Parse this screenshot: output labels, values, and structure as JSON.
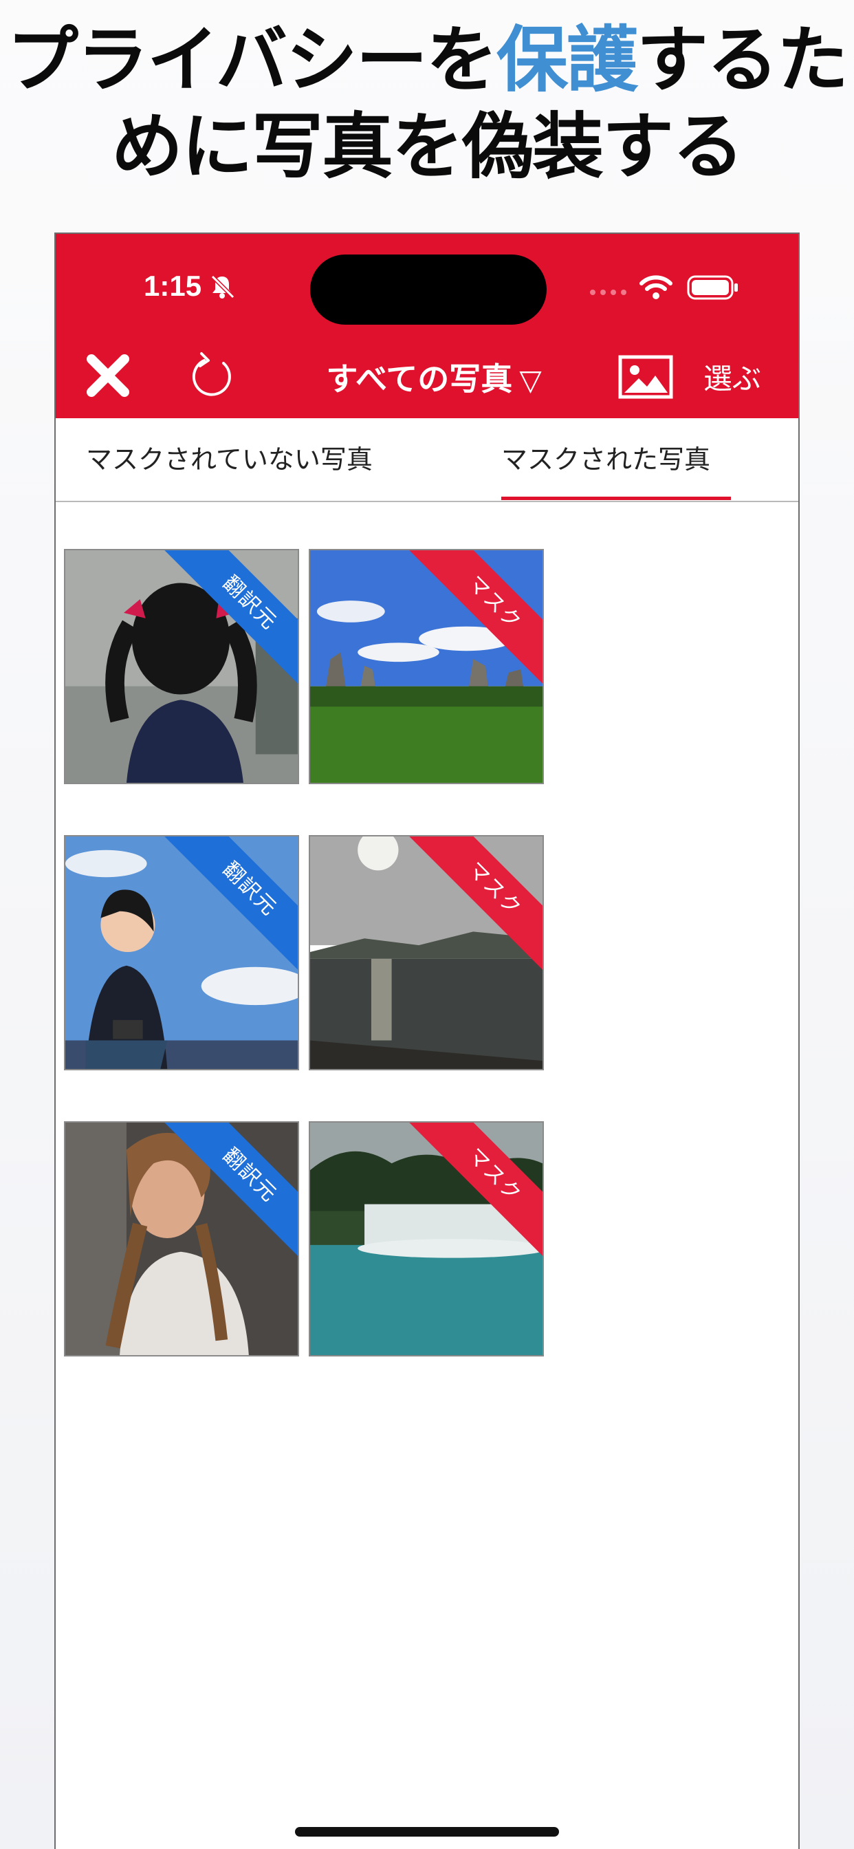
{
  "headline": {
    "line1_before": "プライバシーを",
    "line1_accent": "保護",
    "line1_after": "するた",
    "line2": "めに写真を偽装する"
  },
  "status_bar": {
    "time": "1:15",
    "icons": [
      "bell-slash-icon",
      "signal-dots-icon",
      "wifi-icon",
      "battery-icon"
    ]
  },
  "toolbar": {
    "close_icon": "close-icon",
    "refresh_icon": "refresh-icon",
    "title": "すべての写真",
    "title_caret": "▽",
    "image_icon": "image-icon",
    "select_label": "選ぶ"
  },
  "tabs": [
    {
      "label": "マスクされていない写真",
      "selected": false
    },
    {
      "label": "マスクされた写真",
      "selected": true
    }
  ],
  "photos": [
    {
      "badge": "翻訳元",
      "badge_color": "#1f6fd8",
      "subject": "anime-girl-twintails"
    },
    {
      "badge": "マスク",
      "badge_color": "#e31f3c",
      "subject": "stone-forest-landscape"
    },
    {
      "badge": "翻訳元",
      "badge_color": "#1f6fd8",
      "subject": "girl-with-camera-seagulls"
    },
    {
      "badge": "マスク",
      "badge_color": "#e31f3c",
      "subject": "lake-sunset"
    },
    {
      "badge": "翻訳元",
      "badge_color": "#1f6fd8",
      "subject": "woman-with-braids"
    },
    {
      "badge": "マスク",
      "badge_color": "#e31f3c",
      "subject": "waterfall"
    }
  ],
  "colors": {
    "header": "#e0112d",
    "accent_text": "#3f8fd2",
    "tab_indicator": "#e0112d"
  }
}
